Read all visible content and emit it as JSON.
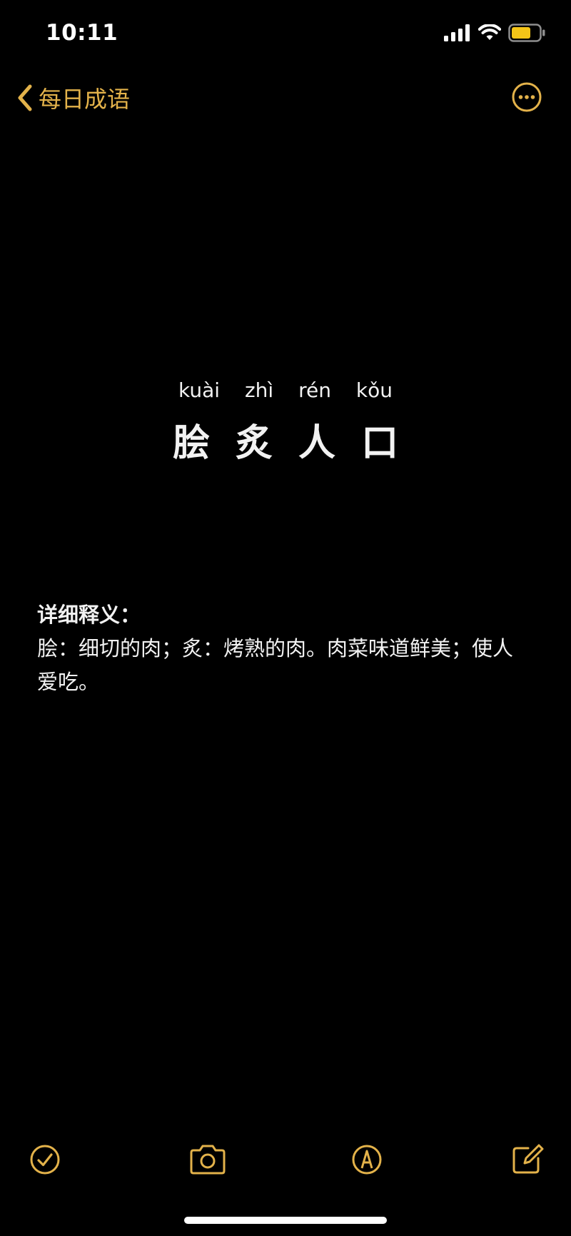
{
  "status_bar": {
    "time": "10:11",
    "signal_icon": "cellular-signal-icon",
    "wifi_icon": "wifi-icon",
    "battery_icon": "battery-icon",
    "battery_color": "#F5C518"
  },
  "nav": {
    "back_label": "每日成语",
    "back_icon": "chevron-left-icon",
    "more_icon": "ellipsis-circle-icon",
    "accent_color": "#E3B24A"
  },
  "idiom": {
    "pinyin": [
      "kuài",
      "zhì",
      "rén",
      "kǒu"
    ],
    "characters": [
      "脍",
      "炙",
      "人",
      "口"
    ]
  },
  "definition": {
    "heading": "详细释义：",
    "body": "脍：细切的肉；炙：烤熟的肉。肉菜味道鲜美；使人爱吃。"
  },
  "toolbar": {
    "checklist_icon": "checklist-icon",
    "camera_icon": "camera-icon",
    "markup_icon": "markup-pen-icon",
    "compose_icon": "compose-icon"
  }
}
